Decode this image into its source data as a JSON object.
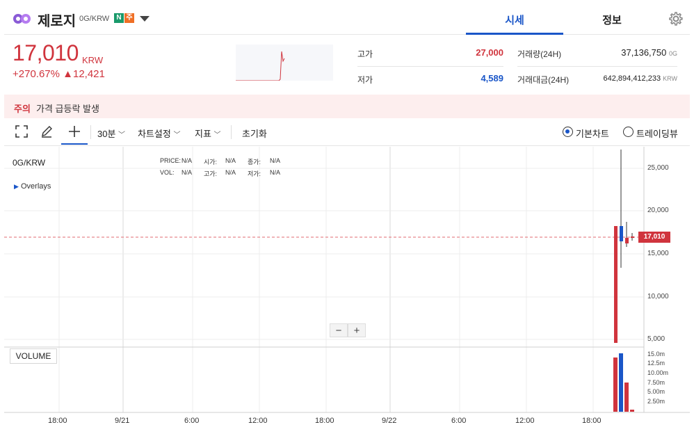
{
  "header": {
    "coin_name": "제로지",
    "pair": "0G/KRW",
    "badge_n": "N",
    "badge_j": "주",
    "tabs": [
      {
        "label": "시세",
        "active": true
      },
      {
        "label": "정보",
        "active": false
      }
    ]
  },
  "ticker": {
    "price": "17,010",
    "unit": "KRW",
    "change": "+270.67% ▲12,421",
    "high_label": "고가",
    "high_value": "27,000",
    "low_label": "저가",
    "low_value": "4,589",
    "volume_label": "거래량(24H)",
    "volume_value": "37,136,750",
    "volume_unit": "0G",
    "amount_label": "거래대금(24H)",
    "amount_value": "642,894,412,233",
    "amount_unit": "KRW"
  },
  "alert": {
    "label": "주의",
    "text": "가격 급등락 발생"
  },
  "toolbar": {
    "interval": "30분",
    "chart_settings": "차트설정",
    "indicators": "지표",
    "reset": "초기화",
    "basic_chart": "기본차트",
    "tradingview": "트레이딩뷰",
    "selected_view": "기본차트"
  },
  "chart": {
    "symbol": "0G/KRW",
    "overlays": "Overlays",
    "price_label": "PRICE:",
    "price_val": "N/A",
    "open_label": "시가:",
    "open_val": "N/A",
    "close_label": "종가:",
    "close_val": "N/A",
    "vol_label": "VOL:",
    "vol_val": "N/A",
    "hi_label": "고가:",
    "hi_val": "N/A",
    "lo_label": "저가:",
    "lo_val": "N/A",
    "zoom_out": "−",
    "zoom_in": "+",
    "volume_pane": "VOLUME",
    "current_price_tag": "17,010",
    "y_ticks": [
      "25,000",
      "20,000",
      "15,000",
      "10,000",
      "5,000"
    ],
    "vol_ticks": [
      "15.0m",
      "12.5m",
      "10.00m",
      "7.50m",
      "5.00m",
      "2.50m"
    ],
    "x_ticks": [
      "18:00",
      "9/21",
      "6:00",
      "12:00",
      "18:00",
      "9/22",
      "6:00",
      "12:00",
      "18:00"
    ]
  },
  "colors": {
    "up": "#d0343d",
    "down": "#1a56c8",
    "accent": "#1a56c8"
  }
}
